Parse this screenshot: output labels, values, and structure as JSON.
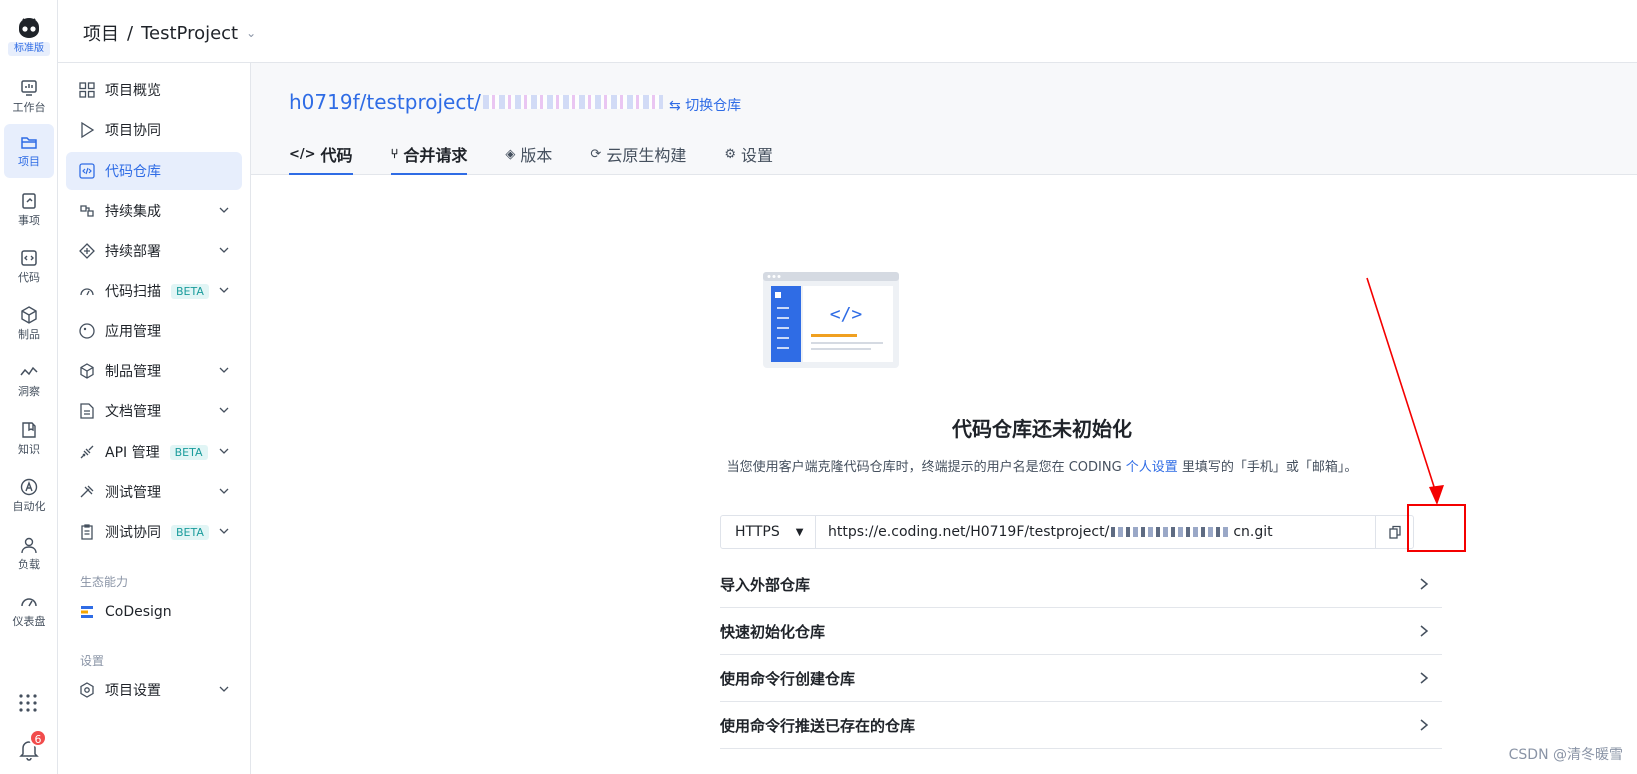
{
  "rail": {
    "edition": "标准版",
    "items": [
      {
        "label": "工作台",
        "icon": "dashboard-icon"
      },
      {
        "label": "项目",
        "icon": "project-icon"
      },
      {
        "label": "事项",
        "icon": "task-icon"
      },
      {
        "label": "代码",
        "icon": "code-icon"
      },
      {
        "label": "制品",
        "icon": "artifact-icon"
      },
      {
        "label": "洞察",
        "icon": "insight-icon"
      },
      {
        "label": "知识",
        "icon": "knowledge-icon"
      },
      {
        "label": "自动化",
        "icon": "automation-icon"
      },
      {
        "label": "负载",
        "icon": "load-icon"
      },
      {
        "label": "仪表盘",
        "icon": "gauge-icon"
      }
    ],
    "notification_count": "6"
  },
  "header": {
    "crumb_root": "项目",
    "separator": "/",
    "project_name": "TestProject"
  },
  "sidebar": {
    "items": [
      {
        "label": "项目概览"
      },
      {
        "label": "项目协同"
      },
      {
        "label": "代码仓库"
      },
      {
        "label": "持续集成"
      },
      {
        "label": "持续部署"
      },
      {
        "label": "代码扫描",
        "badge": "BETA"
      },
      {
        "label": "应用管理"
      },
      {
        "label": "制品管理"
      },
      {
        "label": "文档管理"
      },
      {
        "label": "API 管理",
        "badge": "BETA"
      },
      {
        "label": "测试管理"
      },
      {
        "label": "测试协同",
        "badge": "BETA"
      }
    ],
    "group_eco": "生态能力",
    "codesign": "CoDesign",
    "group_settings": "设置",
    "project_settings": "项目设置"
  },
  "repo": {
    "path_prefix": "h0719f/testproject/",
    "switch_label": "切换仓库",
    "tabs": [
      {
        "label": "代码",
        "icon": "</>"
      },
      {
        "label": "合并请求",
        "icon": "⑂"
      },
      {
        "label": "版本",
        "icon": "◈"
      },
      {
        "label": "云原生构建",
        "icon": "⟳"
      },
      {
        "label": "设置",
        "icon": "⚙"
      }
    ]
  },
  "empty": {
    "title": "代码仓库还未初始化",
    "sub_before": "当您使用客户端克隆代码仓库时，终端提示的用户名是您在 CODING ",
    "sub_link": "个人设置",
    "sub_after": " 里填写的「手机」或「邮箱」。"
  },
  "clone": {
    "protocol": "HTTPS",
    "url_start": "https://e.coding.net/H0719F/testproject/",
    "url_end": "cn.git"
  },
  "sections": [
    {
      "label": "导入外部仓库"
    },
    {
      "label": "快速初始化仓库"
    },
    {
      "label": "使用命令行创建仓库"
    },
    {
      "label": "使用命令行推送已存在的仓库"
    }
  ],
  "watermark": "CSDN @清冬暖雪",
  "colors": {
    "accent": "#2f6ce5",
    "annotation": "#f40000"
  }
}
